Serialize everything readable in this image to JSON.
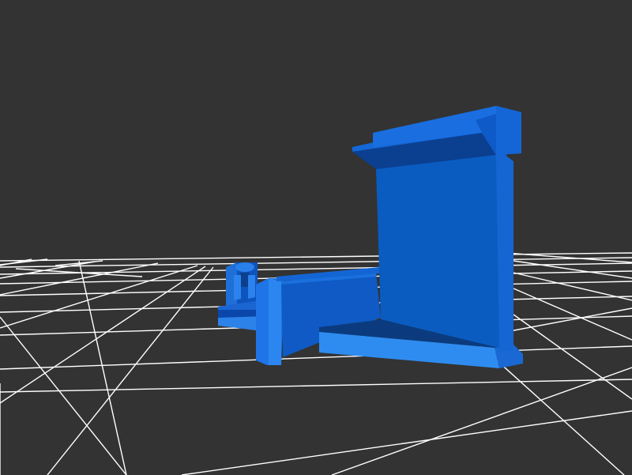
{
  "scene": {
    "background_color": "#333333",
    "grid_color": "#ffffff",
    "model_color": "#1a5fd0",
    "model_highlight_color": "#2e8cf0",
    "model_shadow_color": "#0b3f93"
  }
}
